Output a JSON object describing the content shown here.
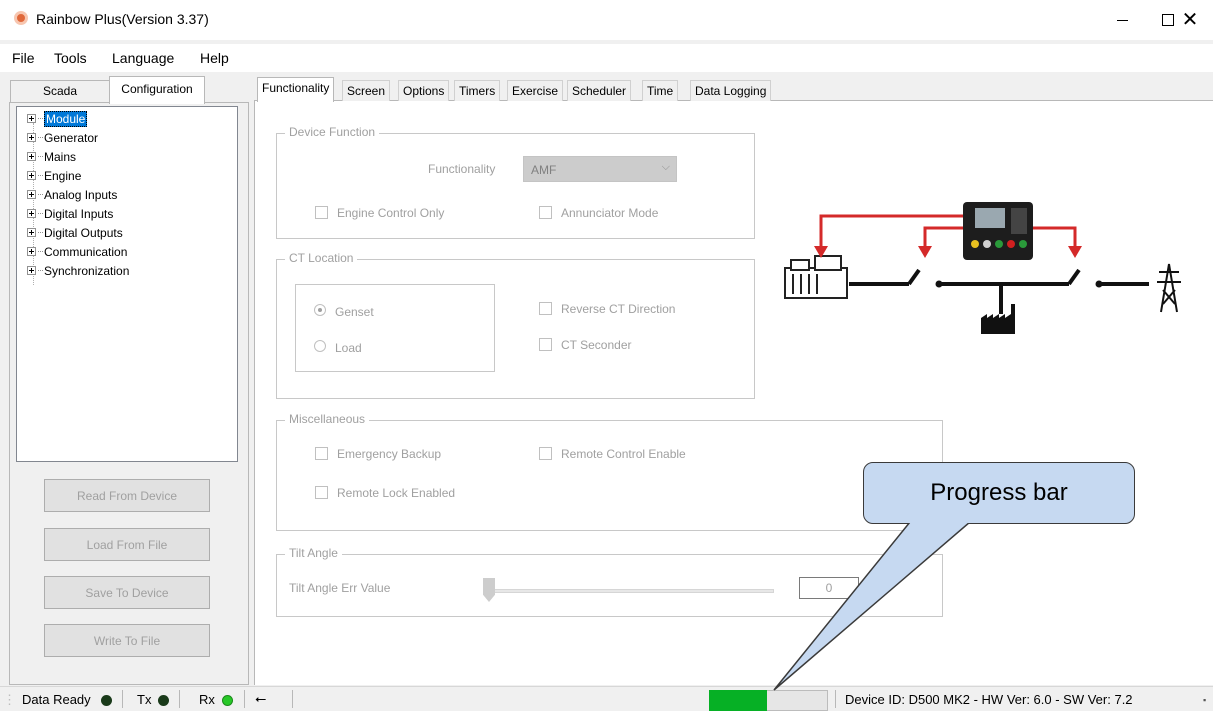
{
  "window": {
    "title": "Rainbow Plus(Version 3.37)",
    "minimize_icon": "minimize-icon",
    "maximize_icon": "maximize-icon",
    "close_glyph": "✕"
  },
  "menu": [
    "File",
    "Tools",
    "Language",
    "Help"
  ],
  "left_tabs": {
    "scada": "Scada",
    "configuration": "Configuration",
    "active": "Configuration"
  },
  "tree": {
    "items": [
      "Module",
      "Generator",
      "Mains",
      "Engine",
      "Analog Inputs",
      "Digital Inputs",
      "Digital Outputs",
      "Communication",
      "Synchronization"
    ],
    "selected": "Module"
  },
  "left_buttons": {
    "read": "Read From Device",
    "load": "Load From File",
    "save": "Save To Device",
    "write": "Write To File"
  },
  "right_tabs": [
    "Functionality",
    "Screen",
    "Options",
    "Timers",
    "Exercise",
    "Scheduler",
    "Time",
    "Data Logging"
  ],
  "active_right_tab": "Functionality",
  "device_function": {
    "group_label": "Device Function",
    "functionality_label": "Functionality",
    "functionality_value": "AMF",
    "engine_control_only": "Engine Control Only",
    "annunciator_mode": "Annunciator Mode"
  },
  "ct_location": {
    "group_label": "CT Location",
    "genset": "Genset",
    "load": "Load",
    "selected": "Genset",
    "reverse_ct": "Reverse CT Direction",
    "ct_seconder": "CT Seconder"
  },
  "miscellaneous": {
    "group_label": "Miscellaneous",
    "emergency_backup": "Emergency Backup",
    "remote_control_enable": "Remote Control Enable",
    "remote_lock_enabled": "Remote Lock Enabled"
  },
  "tilt_angle": {
    "group_label": "Tilt Angle",
    "err_label": "Tilt Angle Err Value",
    "value": "0",
    "slider_fraction": 0
  },
  "callout": {
    "text": "Progress bar",
    "color": "#c6d9f1"
  },
  "status": {
    "data_ready": "Data Ready",
    "tx": "Tx",
    "rx": "Rx",
    "usb_icon": "usb-icon",
    "progress_fraction": 0.49,
    "progress_color": "#06b025",
    "device_info": "Device ID: D500 MK2 - HW Ver: 6.0 - SW Ver: 7.2"
  },
  "colors": {
    "selection": "#0078d7",
    "led_rx": "#28c828",
    "led_dark": "#1a3a1a",
    "diagram_arrow": "#d42a2a"
  }
}
